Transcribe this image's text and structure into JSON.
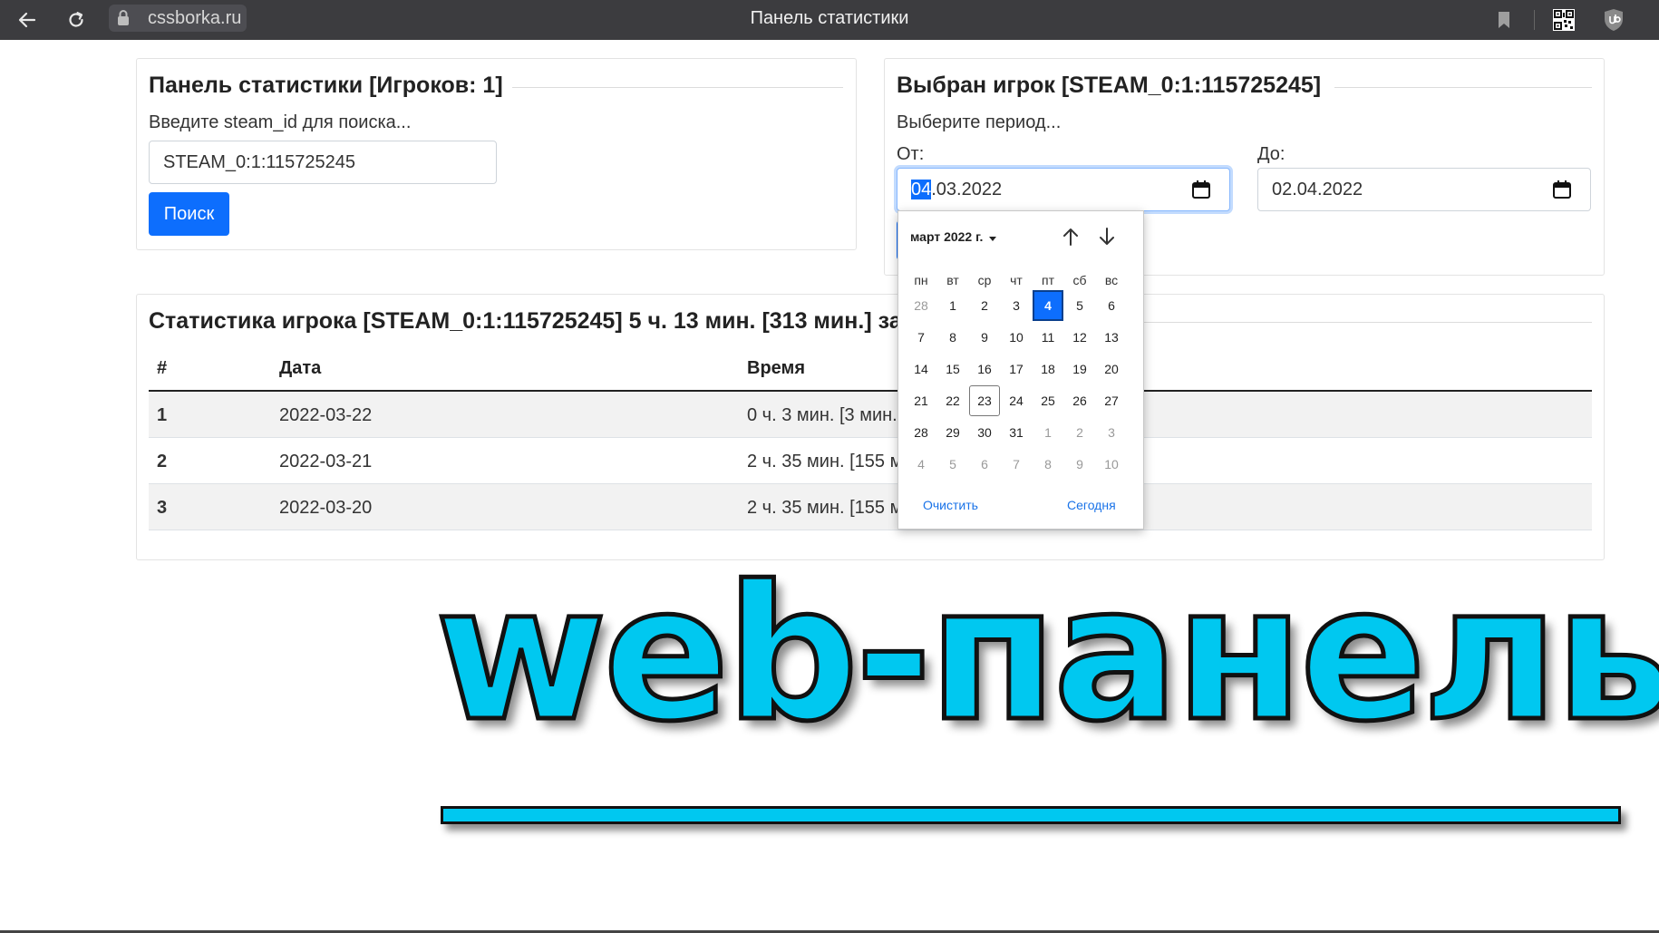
{
  "browser": {
    "url": "cssborka.ru",
    "window_title": "Панель статистики"
  },
  "search_panel": {
    "title": "Панель статистики [Игроков: 1]",
    "prompt": "Введите steam_id для поиска...",
    "input_value": "STEAM_0:1:115725245",
    "button_label": "Поиск"
  },
  "player_panel": {
    "title": "Выбран игрок [STEAM_0:1:115725245]",
    "prompt": "Выберите период...",
    "from_label": "От:",
    "from_value_selected": "04",
    "from_value_rest": ".03.2022",
    "to_label": "До:",
    "to_value": "02.04.2022"
  },
  "stats": {
    "title": "Статистика игрока [STEAM_0:1:115725245] 5 ч. 13 мин. [313 мин.] за",
    "headers": [
      "#",
      "Дата",
      "Время"
    ],
    "rows": [
      {
        "num": "1",
        "date": "2022-03-22",
        "time": "0 ч. 3 мин. [3 мин."
      },
      {
        "num": "2",
        "date": "2022-03-21",
        "time": "2 ч. 35 мин. [155 м"
      },
      {
        "num": "3",
        "date": "2022-03-20",
        "time": "2 ч. 35 мин. [155 м"
      }
    ]
  },
  "datepicker": {
    "month_label": "март 2022 г.",
    "weekdays": [
      "пн",
      "вт",
      "ср",
      "чт",
      "пт",
      "сб",
      "вс"
    ],
    "weeks": [
      [
        "28",
        "1",
        "2",
        "3",
        "4",
        "5",
        "6"
      ],
      [
        "7",
        "8",
        "9",
        "10",
        "11",
        "12",
        "13"
      ],
      [
        "14",
        "15",
        "16",
        "17",
        "18",
        "19",
        "20"
      ],
      [
        "21",
        "22",
        "23",
        "24",
        "25",
        "26",
        "27"
      ],
      [
        "28",
        "29",
        "30",
        "31",
        "1",
        "2",
        "3"
      ],
      [
        "4",
        "5",
        "6",
        "7",
        "8",
        "9",
        "10"
      ]
    ],
    "selected_day": "4",
    "today_day": "23",
    "clear_label": "Очистить",
    "today_label": "Сегодня"
  },
  "overlay": {
    "title": "web-панель"
  },
  "icons": [
    "back-arrow-icon",
    "reload-icon",
    "lock-icon",
    "bookmark-icon",
    "qr-code-icon",
    "ublock-shield-icon",
    "calendar-icon",
    "arrow-up-icon",
    "arrow-down-icon",
    "caret-down-icon"
  ],
  "colors": {
    "primary": "#0d6efd",
    "browser_bar": "#3c3c3f",
    "overlay_fill": "#00c8f0"
  }
}
